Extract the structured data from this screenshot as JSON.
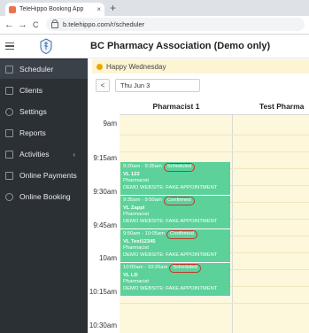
{
  "browser": {
    "tab_title": "TeleHippo Booking App",
    "tab_close": "×",
    "new_tab": "+",
    "back": "←",
    "forward": "→",
    "reload": "C",
    "url": "b.telehippo.com/r/scheduler"
  },
  "app": {
    "org_name": "BC Pharmacy Association (Demo only)",
    "accent_color": "#5cd19a",
    "sidebar_color": "#2b3035"
  },
  "sidebar": {
    "items": [
      {
        "label": "Scheduler",
        "icon": "calendar-icon",
        "active": true
      },
      {
        "label": "Clients",
        "icon": "people-icon"
      },
      {
        "label": "Settings",
        "icon": "gear-icon"
      },
      {
        "label": "Reports",
        "icon": "chart-icon"
      },
      {
        "label": "Activities",
        "icon": "list-icon",
        "chevron": "‹"
      },
      {
        "label": "Online Payments",
        "icon": "card-icon"
      },
      {
        "label": "Online Booking",
        "icon": "globe-icon"
      }
    ]
  },
  "greeting": {
    "text": "Happy Wednesday"
  },
  "datebar": {
    "prev": "<",
    "date": "Thu Jun 3"
  },
  "calendar": {
    "columns": [
      "Pharmacist 1",
      "Test Pharma"
    ],
    "times": [
      "9am",
      "9:15am",
      "9:30am",
      "9:45am",
      "10am",
      "10:15am",
      "10:30am"
    ],
    "appointments": [
      {
        "time": "9:20am - 9:35am",
        "status": "Scheduled",
        "client": "VL 123",
        "staff": "Pharmacist",
        "service": "DEMO WEBSITE: FAKE APPOINTMENT"
      },
      {
        "time": "9:35am - 9:50am",
        "status": "Confirmed",
        "client": "VL Zappl",
        "staff": "Pharmacist",
        "service": "DEMO WEBSITE: FAKE APPOINTMENT"
      },
      {
        "time": "9:50am - 10:05am",
        "status": "Confirmed",
        "client": "VL Test12345",
        "staff": "Pharmacist",
        "service": "DEMO WEBSITE: FAKE APPOINTMENT"
      },
      {
        "time": "10:05am - 10:20am",
        "status": "Scheduled",
        "client": "VL LD",
        "staff": "Pharmacist",
        "service": "DEMO WEBSITE: FAKE APPOINTMENT"
      }
    ]
  }
}
